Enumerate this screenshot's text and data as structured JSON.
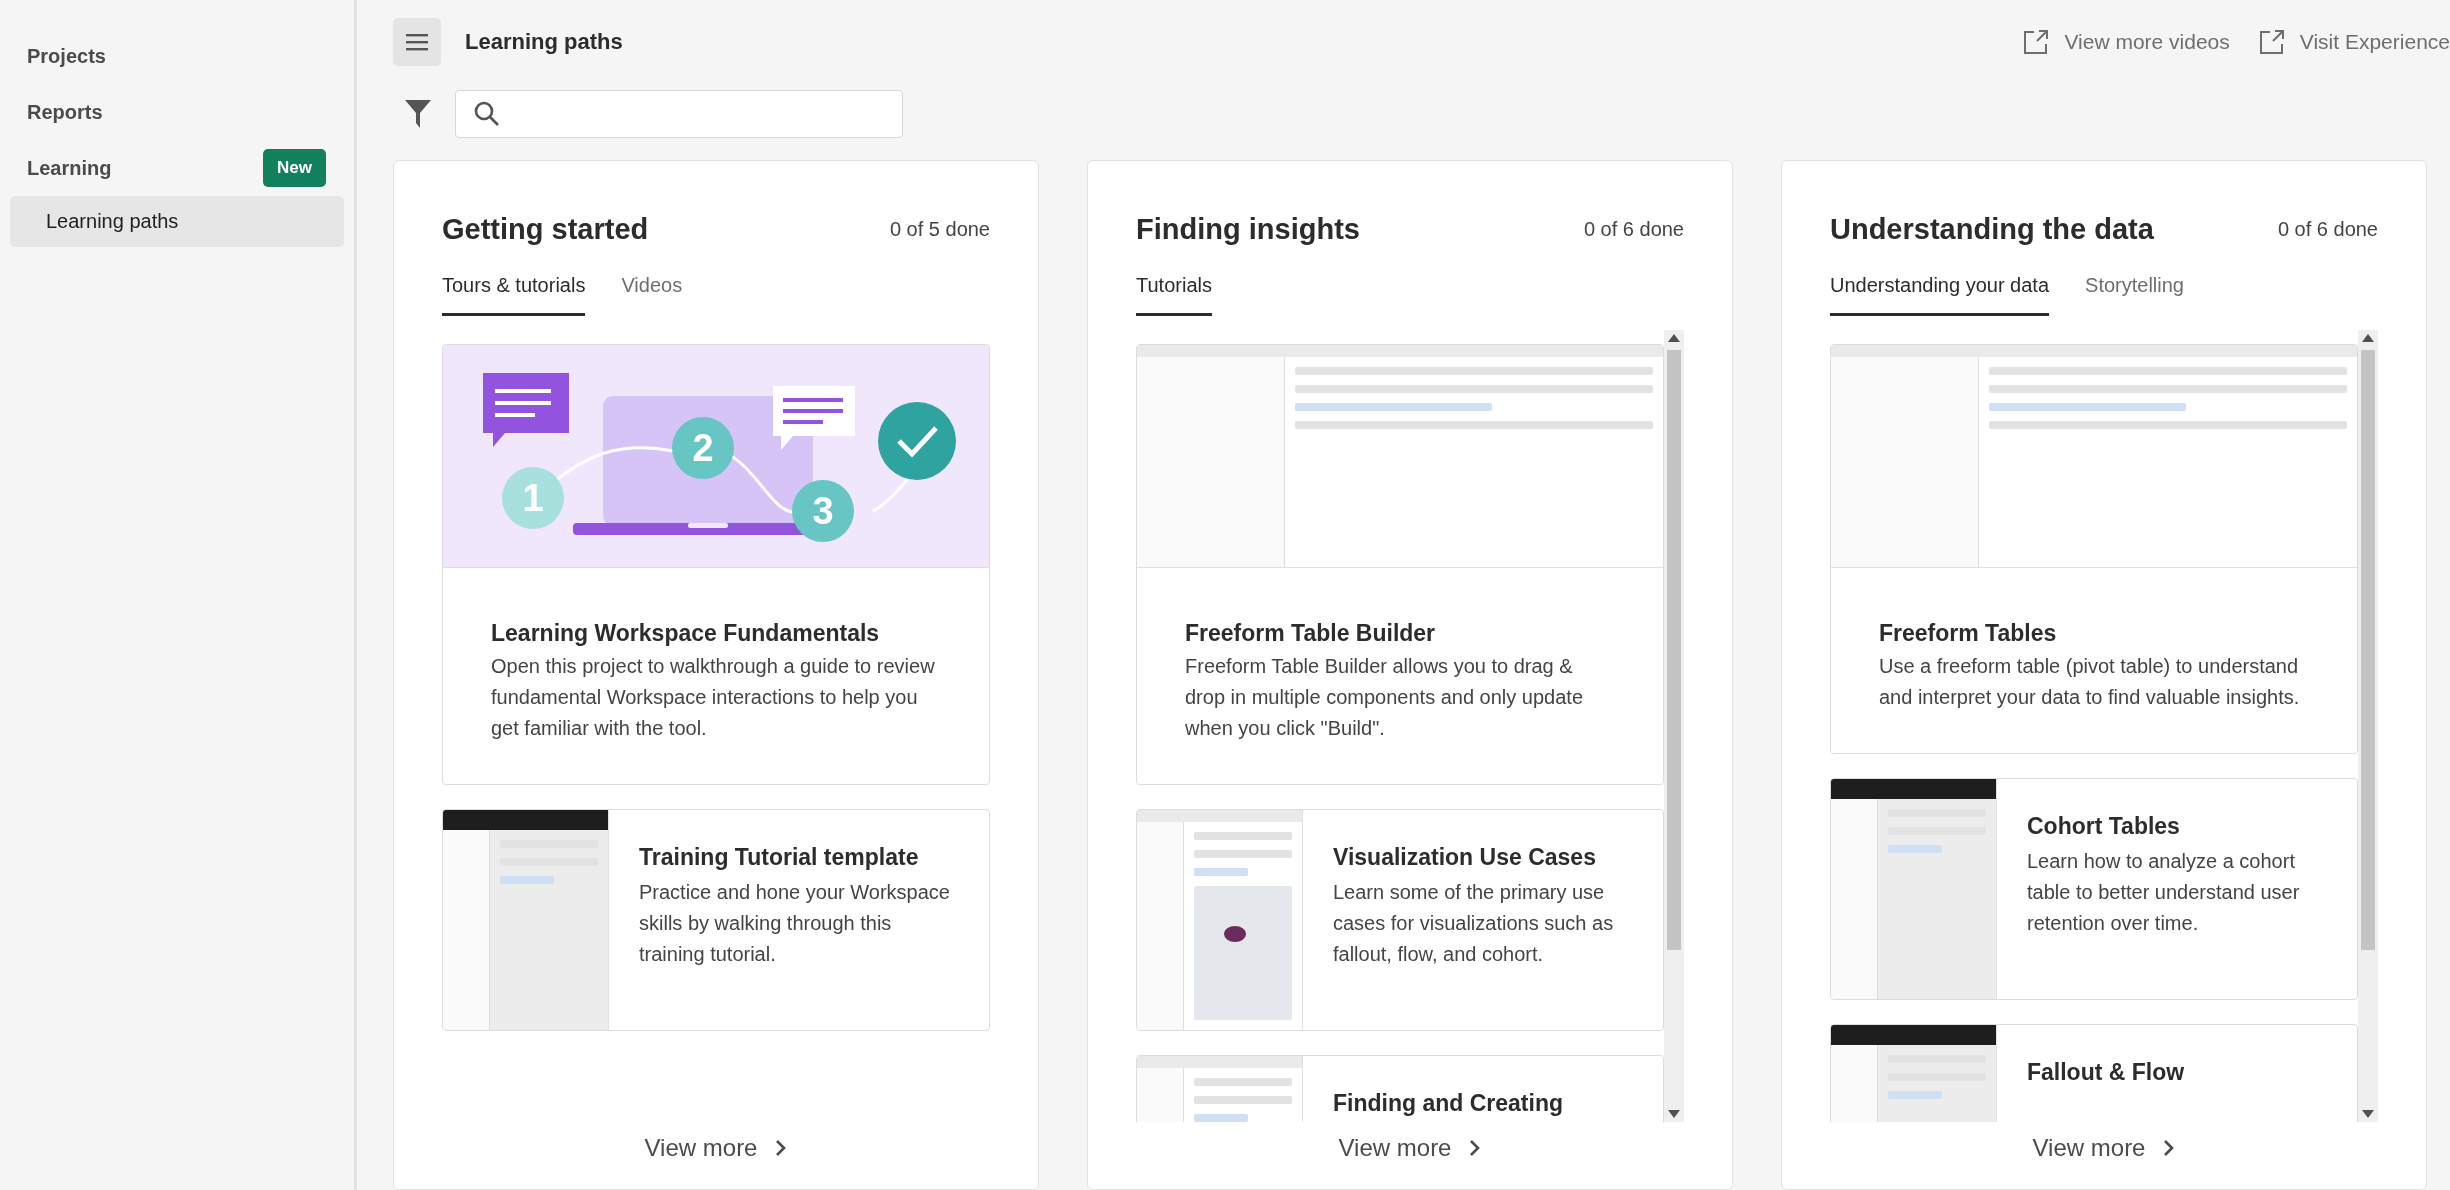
{
  "sidebar": {
    "items": [
      {
        "label": "Projects",
        "selected": false
      },
      {
        "label": "Reports",
        "selected": false
      },
      {
        "label": "Learning",
        "selected": false,
        "badge": "New",
        "children": [
          {
            "label": "Learning paths",
            "selected": true
          }
        ]
      }
    ]
  },
  "header": {
    "title": "Learning paths",
    "links": [
      "View more videos",
      "Visit Experience"
    ]
  },
  "paths": [
    {
      "title": "Getting started",
      "progress": "0 of 5 done",
      "scrollable": false,
      "tabs": [
        {
          "label": "Tours & tutorials",
          "selected": true
        },
        {
          "label": "Videos",
          "selected": false
        }
      ],
      "items": [
        {
          "kind": "featured",
          "steps": [
            "1",
            "2",
            "3"
          ],
          "title": "Learning Workspace Fundamentals",
          "description": "Open this project to walkthrough a guide to review fundamental Workspace interactions to help you get familiar with the tool."
        },
        {
          "kind": "row",
          "title": "Training Tutorial template",
          "description": "Practice and hone your Workspace skills by walking through this training tutorial."
        }
      ],
      "view_more": "View more"
    },
    {
      "title": "Finding insights",
      "progress": "0 of 6 done",
      "scrollable": true,
      "tabs": [
        {
          "label": "Tutorials",
          "selected": true
        }
      ],
      "items": [
        {
          "kind": "featured",
          "title": "Freeform Table Builder",
          "description": "Freeform Table Builder allows you to drag & drop in multiple components and only update when you click \"Build\"."
        },
        {
          "kind": "row",
          "title": "Visualization Use Cases",
          "description": "Learn some of the primary use cases for visualizations such as fallout, flow, and cohort."
        },
        {
          "kind": "row",
          "title": "Finding and Creating"
        }
      ],
      "view_more": "View more"
    },
    {
      "title": "Understanding the data",
      "progress": "0 of 6 done",
      "scrollable": true,
      "tabs": [
        {
          "label": "Understanding your data",
          "selected": true
        },
        {
          "label": "Storytelling",
          "selected": false
        }
      ],
      "items": [
        {
          "kind": "featured",
          "title": "Freeform Tables",
          "description": "Use a freeform table (pivot table) to understand and interpret your data to find valuable insights."
        },
        {
          "kind": "row",
          "title": "Cohort Tables",
          "description": "Learn how to analyze a cohort table to better understand user retention over time."
        },
        {
          "kind": "row",
          "title": "Fallout & Flow"
        }
      ],
      "view_more": "View more"
    }
  ]
}
